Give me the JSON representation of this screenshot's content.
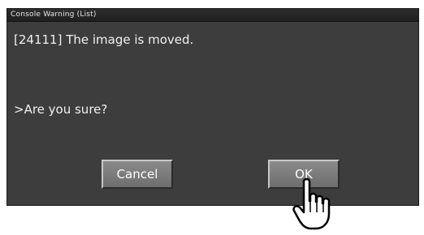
{
  "window": {
    "title": "Console Warning (List)"
  },
  "message": {
    "text": "[24111] The image is moved.",
    "prompt": ">Are you sure?"
  },
  "buttons": {
    "cancel_label": "Cancel",
    "ok_label": "OK"
  },
  "icons": {
    "cursor": "hand-pointer-icon"
  },
  "colors": {
    "dialog_bg": "#3d3d3d",
    "button_bg": "#7c7c7c",
    "text": "#f0f0f0"
  }
}
